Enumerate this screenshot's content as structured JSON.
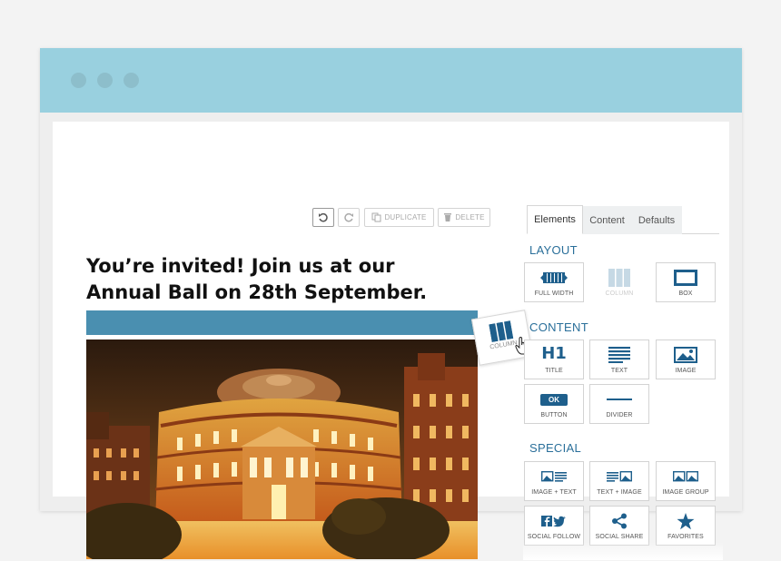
{
  "toolbar": {
    "undo_icon": "undo-icon",
    "redo_icon": "redo-icon",
    "duplicate_label": "DUPLICATE",
    "delete_label": "DELETE"
  },
  "canvas": {
    "headline": "You’re invited! Join us at our Annual Ball on 28th September.",
    "accent_color": "#4a8fb0"
  },
  "drag_preview": {
    "label": "COLUMN"
  },
  "panel": {
    "tabs": [
      {
        "label": "Elements",
        "active": true
      },
      {
        "label": "Content",
        "active": false
      },
      {
        "label": "Defaults",
        "active": false
      }
    ],
    "layout": {
      "title": "LAYOUT",
      "items": [
        {
          "label": "FULL WIDTH",
          "icon": "full-width-icon",
          "disabled": false
        },
        {
          "label": "COLUMN",
          "icon": "column-icon",
          "disabled": true
        },
        {
          "label": "BOX",
          "icon": "box-icon",
          "disabled": false
        }
      ]
    },
    "content": {
      "title": "CONTENT",
      "items": [
        {
          "label": "TITLE",
          "icon": "h1-icon",
          "icon_text": "H1"
        },
        {
          "label": "TEXT",
          "icon": "text-lines-icon"
        },
        {
          "label": "IMAGE",
          "icon": "image-icon"
        },
        {
          "label": "BUTTON",
          "icon": "button-icon",
          "icon_text": "OK"
        },
        {
          "label": "DIVIDER",
          "icon": "divider-icon"
        }
      ]
    },
    "special": {
      "title": "SPECIAL",
      "items": [
        {
          "label": "IMAGE + TEXT",
          "icon": "image-text-icon"
        },
        {
          "label": "TEXT + IMAGE",
          "icon": "text-image-icon"
        },
        {
          "label": "IMAGE GROUP",
          "icon": "image-group-icon"
        },
        {
          "label": "SOCIAL FOLLOW",
          "icon": "social-follow-icon"
        },
        {
          "label": "SOCIAL SHARE",
          "icon": "share-icon"
        },
        {
          "label": "FAVORITES",
          "icon": "star-icon"
        }
      ]
    }
  },
  "colors": {
    "titlebar": "#99d0df",
    "section_title": "#2a6f9a",
    "icon": "#1e5f8c"
  }
}
